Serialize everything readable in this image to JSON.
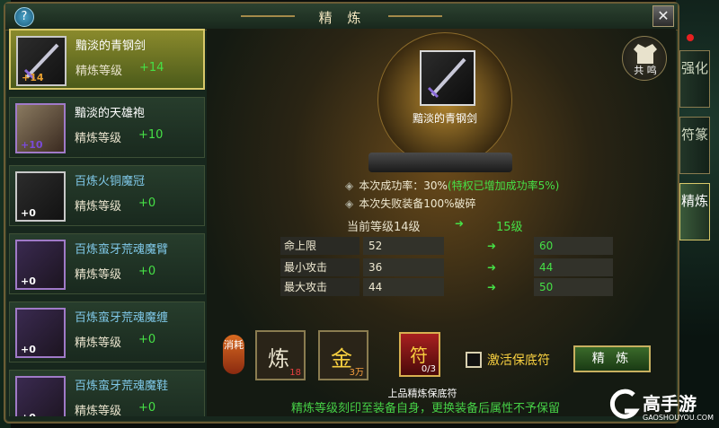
{
  "window": {
    "title": "精 炼",
    "help_icon": "?",
    "close_icon": "✕"
  },
  "items": [
    {
      "name": "黯淡的青钢剑",
      "level_label": "精炼等级",
      "level_value": "+14",
      "thumb_plus": "+14",
      "plus_color": "#e8a030",
      "name_color": "#ffffff",
      "selected": true
    },
    {
      "name": "黯淡的天雄袍",
      "level_label": "精炼等级",
      "level_value": "+10",
      "thumb_plus": "+10",
      "plus_color": "#7a4ad8",
      "name_color": "#ffffff",
      "selected": false
    },
    {
      "name": "百炼火铜魔冠",
      "level_label": "精炼等级",
      "level_value": "+0",
      "thumb_plus": "+0",
      "plus_color": "#ffffff",
      "name_color": "#7fc8e8",
      "selected": false
    },
    {
      "name": "百炼蛮牙荒魂魔臂",
      "level_label": "精炼等级",
      "level_value": "+0",
      "thumb_plus": "+0",
      "plus_color": "#ffffff",
      "name_color": "#7fc8e8",
      "selected": false
    },
    {
      "name": "百炼蛮牙荒魂魔缠",
      "level_label": "精炼等级",
      "level_value": "+0",
      "thumb_plus": "+0",
      "plus_color": "#ffffff",
      "name_color": "#7fc8e8",
      "selected": false
    },
    {
      "name": "百炼蛮牙荒魂魔鞋",
      "level_label": "精炼等级",
      "level_value": "+0",
      "thumb_plus": "+0",
      "plus_color": "#ffffff",
      "name_color": "#7fc8e8",
      "selected": false
    }
  ],
  "center": {
    "item_name": "黯淡的青钢剑",
    "resonate_label": "共 鸣",
    "success_rate": "本次成功率：30%",
    "success_bonus": "(特权已增加成功率5%)",
    "fail_text": "本次失败装备100%破碎",
    "current_level": "当前等级14级",
    "next_level": "15级",
    "stats": [
      {
        "name": "命上限",
        "value": "52",
        "new_value": "60"
      },
      {
        "name": "最小攻击",
        "value": "36",
        "new_value": "44"
      },
      {
        "name": "最大攻击",
        "value": "44",
        "new_value": "50"
      }
    ]
  },
  "bottom": {
    "consume_label": "消耗",
    "materials": [
      {
        "icon": "炼",
        "qty": "18"
      },
      {
        "icon": "金",
        "qty": "3万"
      }
    ],
    "protect_icon": "符",
    "protect_qty": "0/3",
    "protect_label": "上品精炼保底符",
    "checkbox_label": "激活保底符",
    "refine_button": "精 炼",
    "warning": "精炼等级刻印至装备自身，更换装备后属性不予保留"
  },
  "tabs": [
    {
      "label": "强化",
      "active": false
    },
    {
      "label": "符篆",
      "active": false
    },
    {
      "label": "精炼",
      "active": true
    }
  ],
  "watermark": {
    "brand": "高手游",
    "url": "GAOSHOUYOU.COM"
  },
  "colors": {
    "green": "#46e046",
    "gold": "#f8d040",
    "accent": "#d8c86a"
  }
}
